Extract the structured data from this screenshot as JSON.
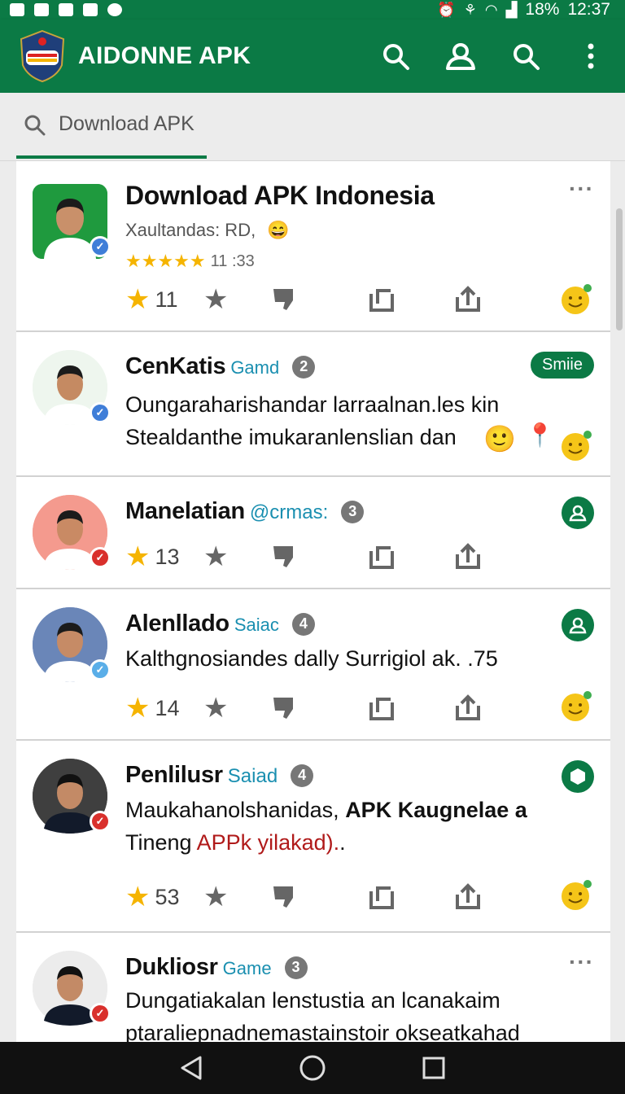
{
  "status": {
    "battery": "18%",
    "time": "12:37"
  },
  "app": {
    "title": "AIDONNE APK",
    "colors": {
      "primary": "#0b7a45",
      "star": "#f5b400",
      "handle": "#1a8fb0"
    },
    "icons": [
      "search-icon",
      "account-icon",
      "search-icon",
      "more-vert-icon"
    ]
  },
  "search": {
    "text": "Download APK"
  },
  "cards": [
    {
      "name": "Download APK Indonesia",
      "sub": "Xaultandas: RD,",
      "rating_text": "11 :33",
      "stars": 5,
      "count": "11"
    },
    {
      "name": "CenKatis",
      "handle": "Gamd",
      "num": "2",
      "pill": "Smiie",
      "line1": "Oungaraharishandar larraalnan.les kin",
      "line2": "Stealdanthe imukaranlenslian dan"
    },
    {
      "name": "Manelatian",
      "handle": "@crmas:",
      "num": "3",
      "count": "13"
    },
    {
      "name": "Alenllado",
      "handle": "Saiac",
      "num": "4",
      "line1": "Kalthgnosiandes dally Surrigiol ak. .75",
      "count": "14"
    },
    {
      "name": "Penlilusr",
      "handle": "Saiad",
      "num": "4",
      "line1_plain": "Maukahanolshanidas, ",
      "line1_bold": "APK Kaugnelae a",
      "line2_plain": "Tineng ",
      "line2_red": "APPk yilakad).",
      "line2_end": ".",
      "count": "53"
    },
    {
      "name": "Dukliosr",
      "handle": "Game",
      "num": "3",
      "line1": "Dungatiakalan lenstustia an lcanakaim",
      "line2": "ptaraliepnadnemastainstoir okseatkahad"
    }
  ]
}
